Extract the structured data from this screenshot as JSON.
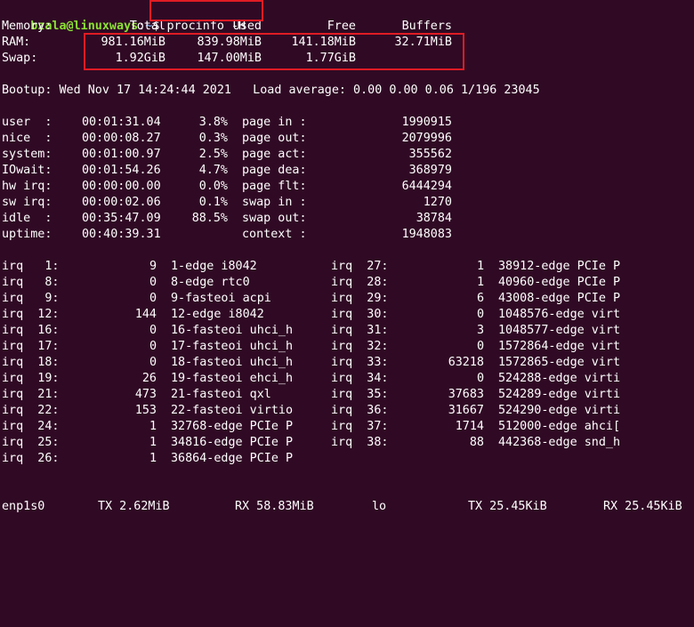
{
  "prompt": {
    "user_host": "bzala@linuxways",
    "sep": ":",
    "path": "~",
    "symbol": "$ ",
    "command": "procinfo -H"
  },
  "memory": {
    "header": {
      "label": "Memory:",
      "total": "Total",
      "used": "Used",
      "free": "Free",
      "buffers": "Buffers"
    },
    "ram": {
      "label": "RAM:",
      "total": "981.16MiB",
      "used": "839.98MiB",
      "free": "141.18MiB",
      "buffers": "32.71MiB"
    },
    "swap": {
      "label": "Swap:",
      "total": "1.92GiB",
      "used": "147.00MiB",
      "free": "1.77GiB"
    }
  },
  "bootup": "Bootup: Wed Nov 17 14:24:44 2021   Load average: 0.00 0.00 0.06 1/196 23045",
  "cpu": [
    {
      "label": "user  :",
      "time": "00:01:31.04",
      "pct": "3.8%"
    },
    {
      "label": "nice  :",
      "time": "00:00:08.27",
      "pct": "0.3%"
    },
    {
      "label": "system:",
      "time": "00:01:00.97",
      "pct": "2.5%"
    },
    {
      "label": "IOwait:",
      "time": "00:01:54.26",
      "pct": "4.7%"
    },
    {
      "label": "hw irq:",
      "time": "00:00:00.00",
      "pct": "0.0%"
    },
    {
      "label": "sw irq:",
      "time": "00:00:02.06",
      "pct": "0.1%"
    },
    {
      "label": "idle  :",
      "time": "00:35:47.09",
      "pct": "88.5%"
    },
    {
      "label": "uptime:",
      "time": "00:40:39.31",
      "pct": ""
    }
  ],
  "pages": [
    {
      "label": "page in :",
      "value": "1990915"
    },
    {
      "label": "page out:",
      "value": "2079996"
    },
    {
      "label": "page act:",
      "value": "355562"
    },
    {
      "label": "page dea:",
      "value": "368979"
    },
    {
      "label": "page flt:",
      "value": "6444294"
    },
    {
      "label": "swap in :",
      "value": "1270"
    },
    {
      "label": "swap out:",
      "value": "38784"
    },
    {
      "label": "context :",
      "value": "1948083"
    }
  ],
  "irq_left": [
    {
      "label": "irq   1:",
      "count": "9",
      "desc": "1-edge i8042"
    },
    {
      "label": "irq   8:",
      "count": "0",
      "desc": "8-edge rtc0"
    },
    {
      "label": "irq   9:",
      "count": "0",
      "desc": "9-fasteoi acpi"
    },
    {
      "label": "irq  12:",
      "count": "144",
      "desc": "12-edge i8042"
    },
    {
      "label": "irq  16:",
      "count": "0",
      "desc": "16-fasteoi uhci_h"
    },
    {
      "label": "irq  17:",
      "count": "0",
      "desc": "17-fasteoi uhci_h"
    },
    {
      "label": "irq  18:",
      "count": "0",
      "desc": "18-fasteoi uhci_h"
    },
    {
      "label": "irq  19:",
      "count": "26",
      "desc": "19-fasteoi ehci_h"
    },
    {
      "label": "irq  21:",
      "count": "473",
      "desc": "21-fasteoi qxl"
    },
    {
      "label": "irq  22:",
      "count": "153",
      "desc": "22-fasteoi virtio"
    },
    {
      "label": "irq  24:",
      "count": "1",
      "desc": "32768-edge PCIe P"
    },
    {
      "label": "irq  25:",
      "count": "1",
      "desc": "34816-edge PCIe P"
    },
    {
      "label": "irq  26:",
      "count": "1",
      "desc": "36864-edge PCIe P"
    }
  ],
  "irq_right": [
    {
      "label": "irq  27:",
      "count": "1",
      "desc": "38912-edge PCIe P"
    },
    {
      "label": "irq  28:",
      "count": "1",
      "desc": "40960-edge PCIe P"
    },
    {
      "label": "irq  29:",
      "count": "6",
      "desc": "43008-edge PCIe P"
    },
    {
      "label": "irq  30:",
      "count": "0",
      "desc": "1048576-edge virt"
    },
    {
      "label": "irq  31:",
      "count": "3",
      "desc": "1048577-edge virt"
    },
    {
      "label": "irq  32:",
      "count": "0",
      "desc": "1572864-edge virt"
    },
    {
      "label": "irq  33:",
      "count": "63218",
      "desc": "1572865-edge virt"
    },
    {
      "label": "irq  34:",
      "count": "0",
      "desc": "524288-edge virti"
    },
    {
      "label": "irq  35:",
      "count": "37683",
      "desc": "524289-edge virti"
    },
    {
      "label": "irq  36:",
      "count": "31667",
      "desc": "524290-edge virti"
    },
    {
      "label": "irq  37:",
      "count": "1714",
      "desc": "512000-edge ahci["
    },
    {
      "label": "irq  38:",
      "count": "88",
      "desc": "442368-edge snd_h"
    }
  ],
  "net": {
    "if1": "enp1s0",
    "if1_tx": "TX 2.62MiB",
    "if1_rx": "RX 58.83MiB",
    "if2": "lo",
    "if2_tx": "TX 25.45KiB",
    "if2_rx": "RX 25.45KiB"
  },
  "colors": {
    "background": "#300a24",
    "text": "#ffffff",
    "prompt_user": "#8ae234",
    "prompt_path": "#729fcf",
    "highlight_box": "#e01b24"
  }
}
